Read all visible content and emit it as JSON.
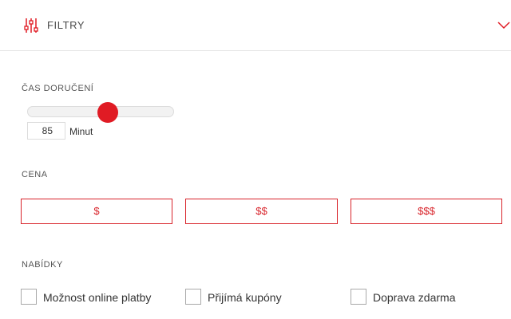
{
  "header": {
    "title": "FILTRY",
    "icon": "sliders-icon",
    "toggle_icon": "chevron-down-icon"
  },
  "delivery_time": {
    "label": "ČAS DORUČENÍ",
    "value": "85",
    "unit": "Minut",
    "slider_level": 0.55
  },
  "price": {
    "label": "CENA",
    "options": [
      "$",
      "$$",
      "$$$"
    ]
  },
  "offers": {
    "label": "NABÍDKY",
    "items": [
      {
        "label": "Možnost online platby",
        "checked": false
      },
      {
        "label": "Přijímá kupóny",
        "checked": false
      },
      {
        "label": "Doprava zdarma",
        "checked": false
      }
    ]
  },
  "colors": {
    "accent": "#e01b24",
    "border": "#dcdcdc"
  }
}
